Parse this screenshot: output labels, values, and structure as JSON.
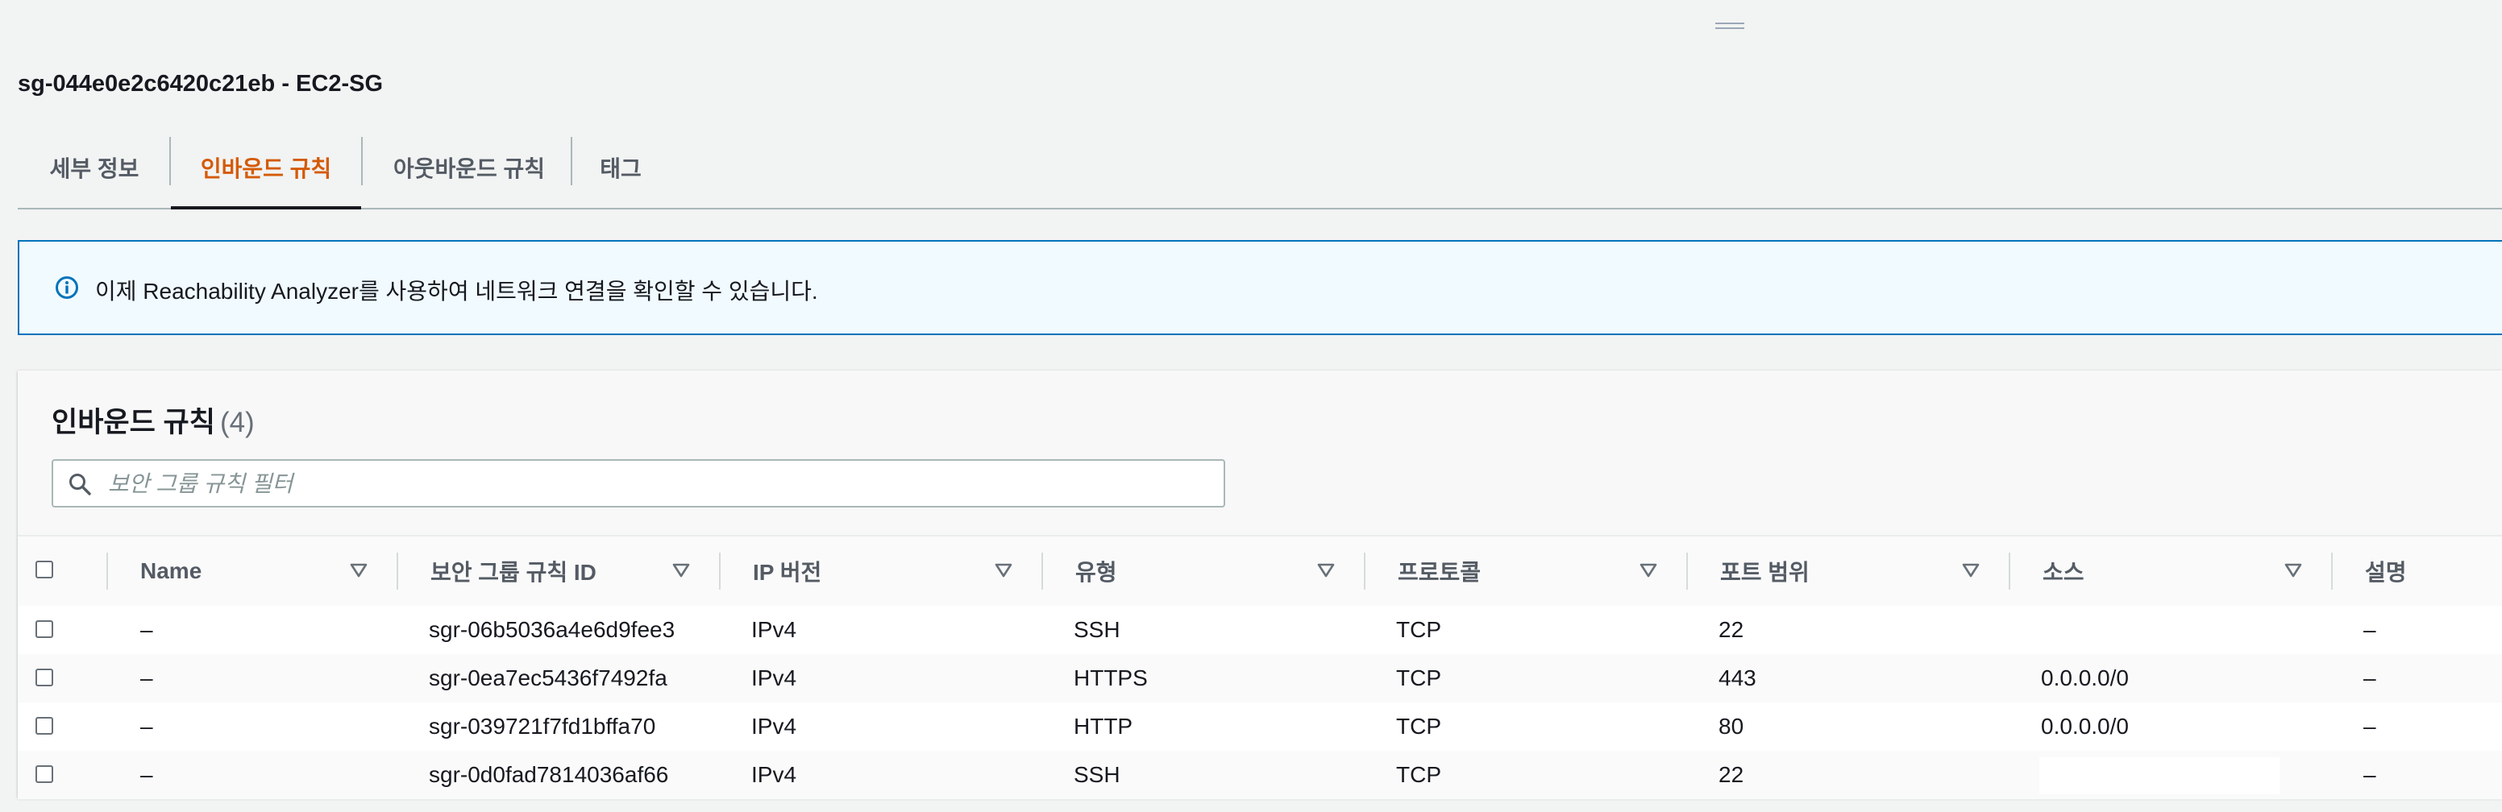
{
  "header": {
    "title": "sg-044e0e2c6420c21eb - EC2-SG"
  },
  "tabs": [
    {
      "label": "세부 정보",
      "active": false
    },
    {
      "label": "인바운드 규칙",
      "active": true
    },
    {
      "label": "아웃바운드 규칙",
      "active": false
    },
    {
      "label": "태그",
      "active": false
    }
  ],
  "alert": {
    "icon": "info-icon",
    "text": "이제 Reachability Analyzer를 사용하여 네트워크 연결을 확인할 수 있습니다."
  },
  "panel": {
    "title": "인바운드 규칙",
    "count": "(4)",
    "filter_placeholder": "보안 그룹 규칙 필터"
  },
  "table": {
    "columns": [
      "Name",
      "보안 그룹 규칙 ID",
      "IP 버전",
      "유형",
      "프로토콜",
      "포트 범위",
      "소스",
      "설명"
    ],
    "rows": [
      {
        "name": "–",
        "rule_id": "sgr-06b5036a4e6d9fee3",
        "ip_version": "IPv4",
        "type": "SSH",
        "protocol": "TCP",
        "port": "22",
        "source": "",
        "description": "–"
      },
      {
        "name": "–",
        "rule_id": "sgr-0ea7ec5436f7492fa",
        "ip_version": "IPv4",
        "type": "HTTPS",
        "protocol": "TCP",
        "port": "443",
        "source": "0.0.0.0/0",
        "description": "–"
      },
      {
        "name": "–",
        "rule_id": "sgr-039721f7fd1bffa70",
        "ip_version": "IPv4",
        "type": "HTTP",
        "protocol": "TCP",
        "port": "80",
        "source": "0.0.0.0/0",
        "description": "–"
      },
      {
        "name": "–",
        "rule_id": "sgr-0d0fad7814036af66",
        "ip_version": "IPv4",
        "type": "SSH",
        "protocol": "TCP",
        "port": "22",
        "source": "",
        "description": "–"
      }
    ]
  },
  "colors": {
    "accent_active_tab": "#d45b07",
    "info_border": "#0073bb",
    "info_background": "#f1faff"
  }
}
